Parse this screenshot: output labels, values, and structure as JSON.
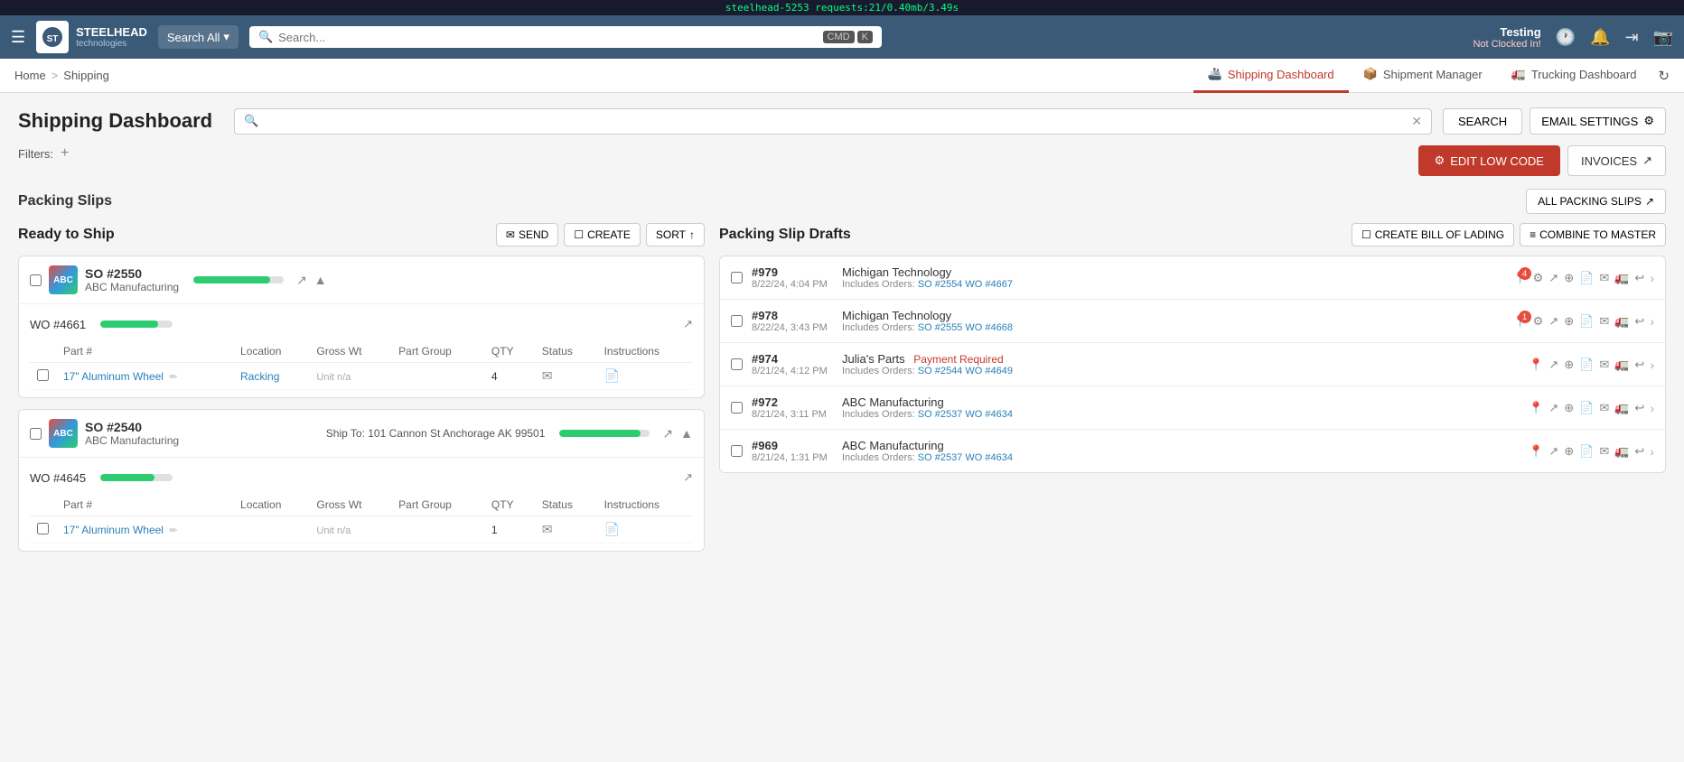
{
  "debug_bar": "steelhead-5253  requests:21/0.40mb/3.49s",
  "top_nav": {
    "logo_line1": "STEELHEAD",
    "logo_line2": "technologies",
    "search_all_label": "Search All",
    "search_placeholder": "Search...",
    "cmd_label": "CMD",
    "k_label": "K",
    "user_name": "Testing",
    "user_status": "Not Clocked In!",
    "clock_icon": "🕐",
    "bell_icon": "🔔",
    "logout_icon": "→",
    "camera_icon": "📷"
  },
  "breadcrumb": {
    "home": "Home",
    "sep": ">",
    "current": "Shipping"
  },
  "tabs": [
    {
      "id": "shipping-dashboard",
      "label": "Shipping Dashboard",
      "active": true,
      "icon": "🚢"
    },
    {
      "id": "shipment-manager",
      "label": "Shipment Manager",
      "active": false,
      "icon": "📦"
    },
    {
      "id": "trucking-dashboard",
      "label": "Trucking Dashboard",
      "active": false,
      "icon": "🚛"
    }
  ],
  "page": {
    "title": "Shipping Dashboard",
    "search_placeholder": "",
    "filters_label": "Filters:",
    "btn_search": "SEARCH",
    "btn_email_settings": "EMAIL SETTINGS",
    "btn_edit_low_code": "EDIT LOW CODE",
    "btn_invoices": "INVOICES",
    "btn_all_packing_slips": "ALL PACKING SLIPS"
  },
  "ready_to_ship": {
    "title": "Ready to Ship",
    "btn_send": "SEND",
    "btn_create": "CREATE",
    "btn_sort": "SORT",
    "slips": [
      {
        "id": "slip-2550",
        "so": "SO #2550",
        "company": "ABC Manufacturing",
        "ship_to": "",
        "progress": 85,
        "wo_items": [
          {
            "wo": "WO #4661",
            "progress": 80,
            "columns": [
              "Part #",
              "Location",
              "Gross Wt",
              "Part Group",
              "QTY",
              "Status",
              "Instructions"
            ],
            "rows": [
              {
                "part": "17\" Aluminum Wheel",
                "location": "Racking",
                "gross_wt": "",
                "gross_wt_unit": "Unit n/a",
                "part_group": "",
                "qty": "4",
                "status_icon": "✉",
                "instructions_icon": "📄"
              }
            ]
          }
        ]
      },
      {
        "id": "slip-2540",
        "so": "SO #2540",
        "company": "ABC Manufacturing",
        "ship_to": "Ship To: 101 Cannon St Anchorage AK 99501",
        "progress": 90,
        "wo_items": [
          {
            "wo": "WO #4645",
            "progress": 75,
            "columns": [
              "Part #",
              "Location",
              "Gross Wt",
              "Part Group",
              "QTY",
              "Status",
              "Instructions"
            ],
            "rows": [
              {
                "part": "17\" Aluminum Wheel",
                "location": "",
                "gross_wt": "",
                "gross_wt_unit": "Unit n/a",
                "part_group": "",
                "qty": "1",
                "status_icon": "✉",
                "instructions_icon": "📄"
              }
            ]
          }
        ]
      }
    ]
  },
  "packing_slip_drafts": {
    "title": "Packing Slip Drafts",
    "btn_create_bill": "CREATE BILL OF LADING",
    "btn_combine": "COMBINE TO MASTER",
    "drafts": [
      {
        "id": 979,
        "date": "8/22/24, 4:04 PM",
        "company": "Michigan Technology",
        "payment_required": false,
        "includes_label": "Includes Orders:",
        "orders": [
          {
            "label": "SO #2554",
            "id": "so2554"
          },
          {
            "label": "WO #4667",
            "id": "wo4667"
          }
        ],
        "notification_count": 4,
        "has_notification": true,
        "notification_on": "location"
      },
      {
        "id": 978,
        "date": "8/22/24, 3:43 PM",
        "company": "Michigan Technology",
        "payment_required": false,
        "includes_label": "Includes Orders:",
        "orders": [
          {
            "label": "SO #2555",
            "id": "so2555"
          },
          {
            "label": "WO #4668",
            "id": "wo4668"
          }
        ],
        "has_notification": true,
        "notification_count": 1,
        "notification_on": "location"
      },
      {
        "id": 974,
        "date": "8/21/24, 4:12 PM",
        "company": "Julia's Parts",
        "payment_required": true,
        "payment_label": "Payment Required",
        "includes_label": "Includes Orders:",
        "orders": [
          {
            "label": "SO #2544",
            "id": "so2544"
          },
          {
            "label": "WO #4649",
            "id": "wo4649"
          }
        ],
        "has_notification": false,
        "notification_count": 0
      },
      {
        "id": 972,
        "date": "8/21/24, 3:11 PM",
        "company": "ABC Manufacturing",
        "payment_required": false,
        "includes_label": "Includes Orders:",
        "orders": [
          {
            "label": "SO #2537",
            "id": "so2537"
          },
          {
            "label": "WO #4634",
            "id": "wo4634"
          }
        ],
        "has_notification": false,
        "notification_count": 0
      },
      {
        "id": 969,
        "date": "8/21/24, 1:31 PM",
        "company": "ABC Manufacturing",
        "payment_required": false,
        "includes_label": "Includes Orders:",
        "orders": [
          {
            "label": "SO #2537",
            "id": "so2537"
          },
          {
            "label": "WO #4634",
            "id": "wo4634"
          }
        ],
        "has_notification": false,
        "notification_count": 0
      }
    ]
  }
}
